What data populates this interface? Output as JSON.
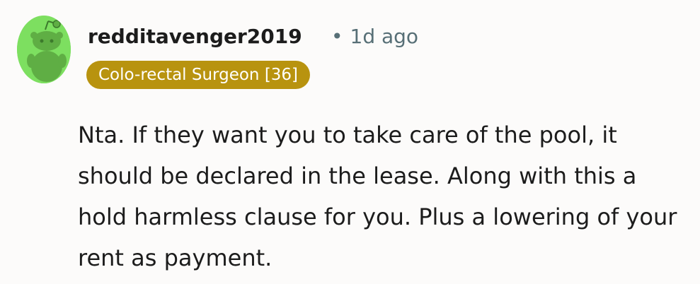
{
  "comment": {
    "author": "redditavenger2019",
    "separator": "•",
    "timestamp": "1d ago",
    "flair": "Colo-rectal Surgeon [36]",
    "body": "Nta. If they want you to take care of the pool, it should be declared in the lease. Along with this a hold harmless clause for you. Plus a lowering of your rent as payment.",
    "avatar_icon": "snoo-avatar-icon"
  },
  "colors": {
    "avatar_bg": "#7ddf60",
    "flair_bg": "#b8930f",
    "flair_text": "#ffffff",
    "meta_text": "#576f76"
  }
}
